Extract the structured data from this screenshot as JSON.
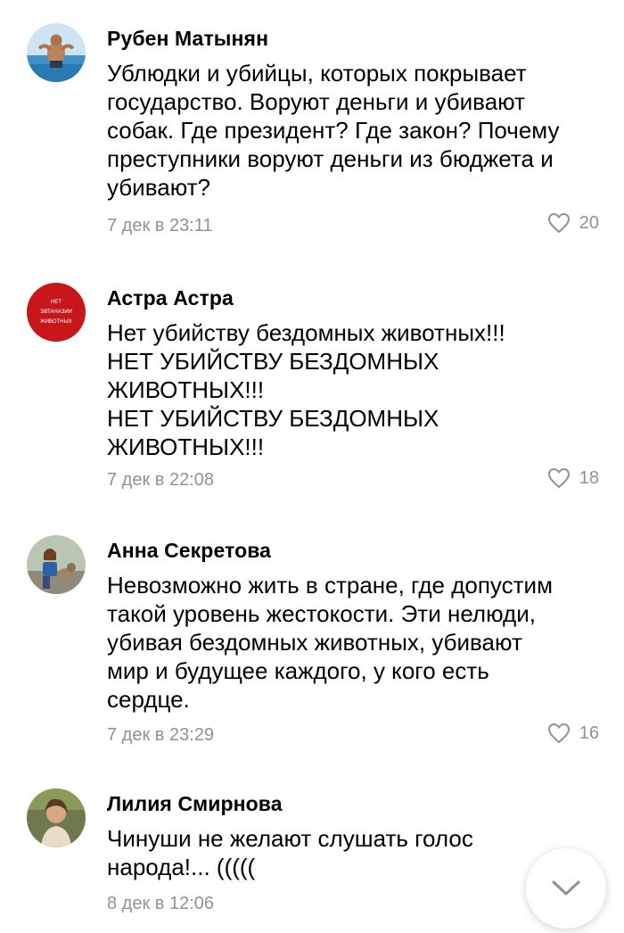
{
  "comments": [
    {
      "author": "Рубен Матынян",
      "text": "Ублюдки и убийцы, которых покрывает\nгосударство. Воруют деньги и убивают\nсобак. Где президент? Где закон? Почему\nпреступники воруют деньги из бюджета и\nубивают?",
      "date": "7 дек в 23:11",
      "likes": "20",
      "avatar_icon": "man-at-beach-avatar"
    },
    {
      "author": "Астра Астра",
      "text": "Нет убийству бездомных животных!!!\nНЕТ УБИЙСТВУ БЕЗДОМНЫХ\nЖИВОТНЫХ!!!\nНЕТ УБИЙСТВУ БЕЗДОМНЫХ\nЖИВОТНЫХ!!!",
      "date": "7 дек в 22:08",
      "likes": "18",
      "avatar_icon": "red-badge-avatar",
      "avatar_badge_text": [
        "НЕТ",
        "ЭВТАНАЗИИ",
        "ЖИВОТНЫХ"
      ]
    },
    {
      "author": "Анна Секретова",
      "text": "Невозможно жить в стране, где допустим\nтакой уровень жестокости. Эти нелюди,\nубивая бездомных животных, убивают\nмир и будущее каждого, у кого есть\nсердце.",
      "date": "7 дек в 23:29",
      "likes": "16",
      "avatar_icon": "woman-with-dog-avatar"
    },
    {
      "author": "Лилия Смирнова",
      "text": "Чинуши не желают слушать голос\nнарода!... (((((",
      "date": "8 дек в 12:06",
      "likes": "",
      "avatar_icon": "woman-portrait-avatar"
    }
  ],
  "icons": {
    "like": "heart-outline-icon",
    "scroll": "chevron-down-icon"
  },
  "colors": {
    "meta_text": "#8d9297",
    "badge_red": "#c8161d",
    "background": "#ffffff"
  }
}
